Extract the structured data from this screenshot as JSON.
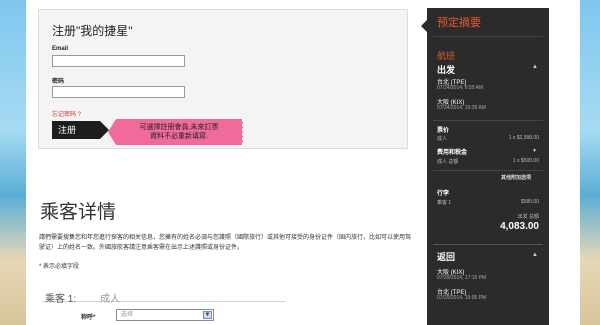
{
  "login": {
    "title": "注册\"我的捷星\"",
    "email_label": "Email",
    "email_value": "",
    "password_label": "密码",
    "password_value": "",
    "forgot": "忘记密码 ?",
    "register_button": "注册",
    "promo_line1": "可選擇註冊會員,未來訂票",
    "promo_line2": "資料不必重新填寫."
  },
  "passenger": {
    "title": "乘客详情",
    "description": "請們需要搜集您和年您進行探客的相关信息，您擁有的姓名必須与您護照（國際旅行）或其他可接受的身份证件（国内旅行，比如可以使用驾驶证）上的姓名一致。外國旅航客請注意乘客需在出示上述護照或身份证件。",
    "required_note": "* 表示必填字段",
    "pax_label": "乘客 1:",
    "pax_type": "成人",
    "title_label": "称呼*",
    "title_select": "选择"
  },
  "summary": {
    "title": "预定摘要",
    "flight_heading": "航班",
    "depart_heading": "出发",
    "collapse_icon": "triangle-up-icon",
    "depart_from_city": "台北 (TPE)",
    "depart_from_date": "07/24/2014, 6:55 AM",
    "depart_to_city": "大阪 (KIX)",
    "depart_to_date": "07/24/2014, 10:35 AM",
    "fare_label": "票价",
    "fare_detail_left": "成人",
    "fare_detail_right": "1 x $2,998.00",
    "fees_label": "费用和税金",
    "fees_detail_left": "成人 总额",
    "fees_detail_right": "1 x $500.00",
    "extras_label": "其他附加选项",
    "luggage_label": "行李",
    "luggage_left": "乘客 1",
    "luggage_right": "$585.00",
    "subtotal_label": "出发 总额",
    "subtotal_value": "4,083.00",
    "return_heading": "返回",
    "return_from_city": "大阪 (KIX)",
    "return_from_date": "07/29/2014, 17:15 PM",
    "return_to_city": "台北 (TPE)",
    "return_to_date": "07/29/2014, 19:05 PM"
  },
  "colors": {
    "accent": "#e8582c",
    "panel_bg": "#2b2b2b",
    "promo_pink": "#f06a9c"
  }
}
